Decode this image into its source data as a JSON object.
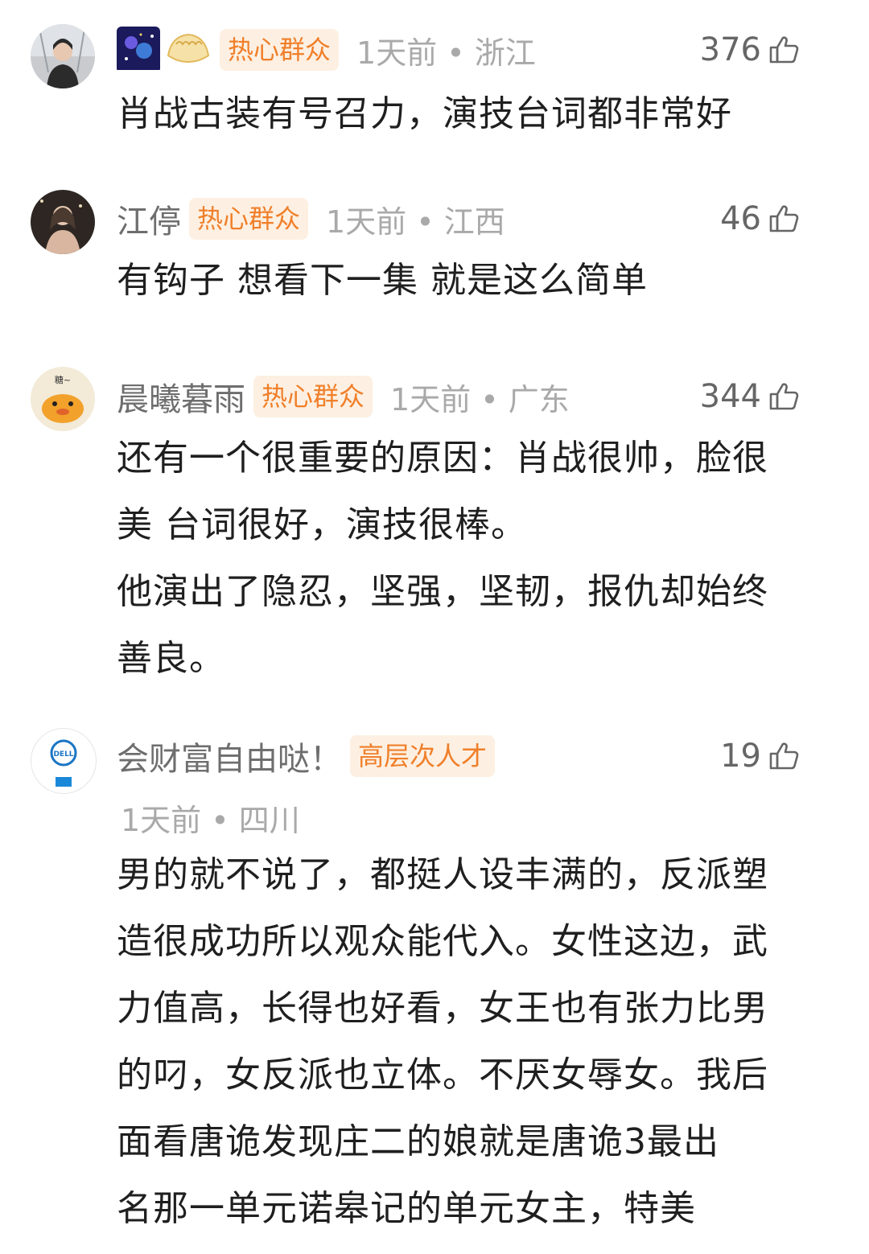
{
  "comments": [
    {
      "username": "",
      "badge": "热心群众",
      "time": "1天前",
      "location": "浙江",
      "likes": "376",
      "text_lines": [
        "肖战古装有号召力，演技台词都非常好"
      ],
      "avatar_icon": "person-photo-icon",
      "username_icons": [
        "galaxy-sticker-icon",
        "dumpling-icon"
      ]
    },
    {
      "username": "江停",
      "badge": "热心群众",
      "time": "1天前",
      "location": "江西",
      "likes": "46",
      "text_lines": [
        "有钩子 想看下一集 就是这么简单"
      ],
      "avatar_icon": "person-photo-icon"
    },
    {
      "username": "晨曦暮雨",
      "badge": "热心群众",
      "time": "1天前",
      "location": "广东",
      "likes": "344",
      "text_lines": [
        "还有一个很重要的原因：肖战很帅，脸很",
        "美 台词很好，演技很棒。",
        "他演出了隐忍，坚强，坚韧，报仇却始终",
        "善良。"
      ],
      "avatar_icon": "cartoon-duck-icon"
    },
    {
      "username": "会财富自由哒！",
      "badge": "高层次人才",
      "time": "1天前",
      "location": "四川",
      "likes": "19",
      "text_lines": [
        "男的就不说了，都挺人设丰满的，反派塑",
        "造很成功所以观众能代入。女性这边，武",
        "力值高，长得也好看，女王也有张力比男",
        "的叼，女反派也立体。不厌女辱女。我后",
        "面看唐诡发现庄二的娘就是唐诡3最出",
        "名那一单元诺皋记的单元女主，特美"
      ],
      "avatar_icon": "dell-logo-icon"
    }
  ],
  "separator": " • ",
  "colors": {
    "badge_bg": "#fdf0e2",
    "badge_text": "#f07f2a",
    "meta": "#a9a9a9",
    "username": "#6e6e6e"
  }
}
